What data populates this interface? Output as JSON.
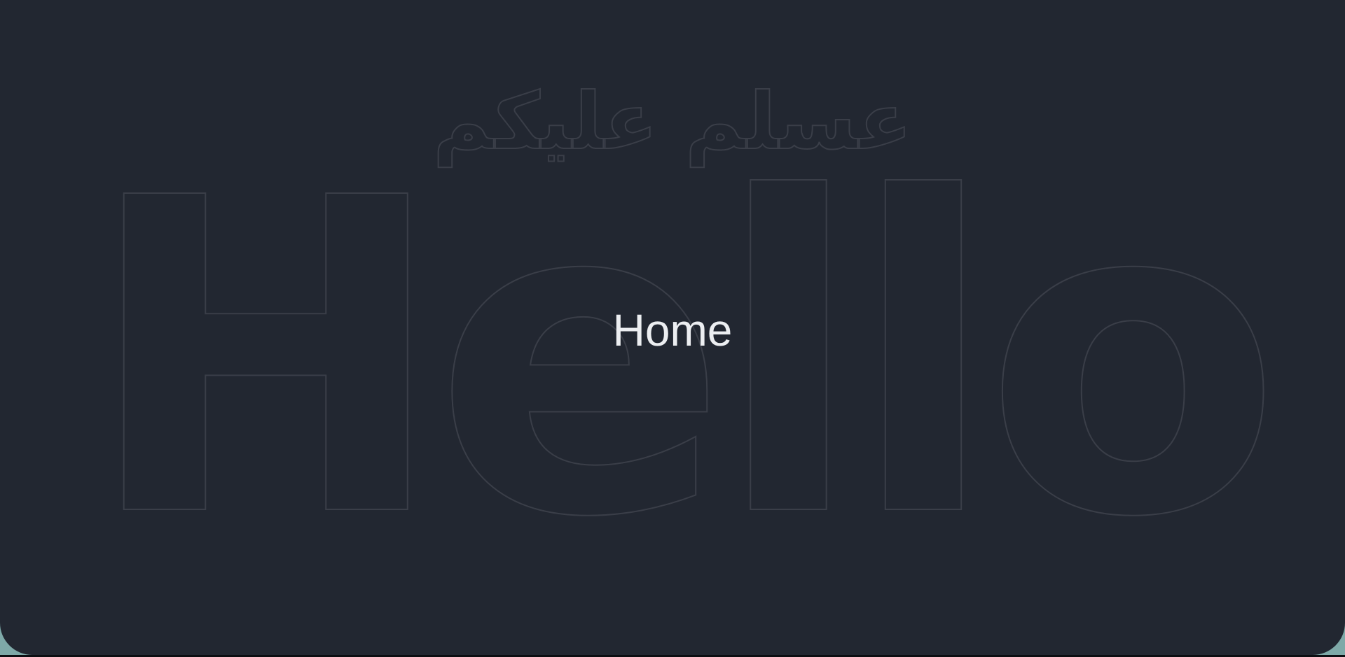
{
  "page": {
    "title": "Home",
    "greeting_arabic": "عسلم عليكم",
    "greeting_latin": "Hello"
  },
  "colors": {
    "background": "#222731",
    "outline_stroke": "#3a3e48",
    "title_text": "#eceef1",
    "backdrop": "#7ea9a8"
  }
}
